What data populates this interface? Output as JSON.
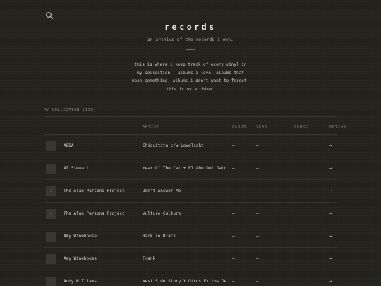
{
  "header": {
    "title": "records",
    "subtitle": "an archive of the records i own.",
    "intro_lines": [
      "this is where i keep track of every vinyl in",
      "my collection — albums i love, albums that",
      "mean something, albums i don't want to forget.",
      "this is my archive."
    ]
  },
  "collection": {
    "label": "MY COLLECTION (158)"
  },
  "table": {
    "columns": [
      "",
      "",
      "ARTIST",
      "ALBUM",
      "YEAR",
      "GENRE",
      "RATING"
    ],
    "rows": [
      {
        "thumb": "",
        "artist": "ABBA",
        "title": "Chiquitita c/w Lovelight",
        "album": "–",
        "year": "–",
        "genre": "",
        "rating": "→"
      },
      {
        "thumb": "",
        "artist": "Al Stewart",
        "title": "Year Of The Cat + El Año Del Gato",
        "album": "–",
        "year": "–",
        "genre": "",
        "rating": "→"
      },
      {
        "thumb": "1",
        "artist": "The Alan Parsons Project",
        "title": "Don't Answer Me",
        "album": "–",
        "year": "–",
        "genre": "",
        "rating": "→"
      },
      {
        "thumb": "1",
        "artist": "The Alan Parsons Project",
        "title": "Vulture Culture",
        "album": "–",
        "year": "–",
        "genre": "",
        "rating": "→"
      },
      {
        "thumb": "",
        "artist": "Amy Winehouse",
        "title": "Back To Black",
        "album": "–",
        "year": "–",
        "genre": "",
        "rating": "→"
      },
      {
        "thumb": "",
        "artist": "Amy Winehouse",
        "title": "Frank",
        "album": "–",
        "year": "–",
        "genre": "",
        "rating": "→"
      },
      {
        "thumb": "",
        "artist": "Andy Williams",
        "title": "West Side Story Y Otros Exitos De",
        "album": "–",
        "year": "–",
        "genre": "",
        "rating": "→"
      }
    ]
  },
  "icons": {
    "search": "search-icon"
  },
  "colors": {
    "background": "#23221c",
    "text": "#d8d4c8",
    "muted": "#8d897e",
    "rule": "#3a3931"
  }
}
